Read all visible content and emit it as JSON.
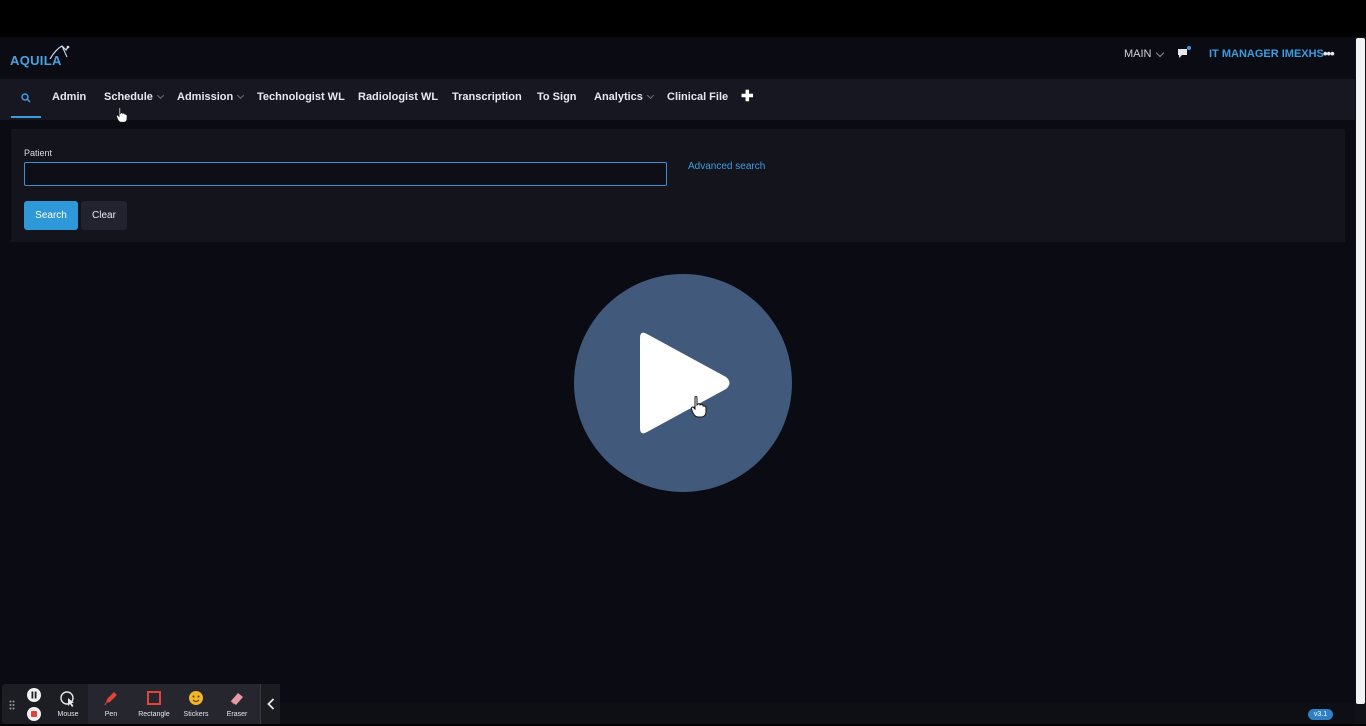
{
  "header": {
    "logo_text": "AQUILA",
    "context_select": "MAIN",
    "user_name": "IT MANAGER IMEXHS",
    "more_label": "•••",
    "chat_icon": "chat-bubble-icon"
  },
  "nav": {
    "search_icon": "search-icon",
    "items": [
      {
        "label": "Admin",
        "dropdown": false
      },
      {
        "label": "Schedule",
        "dropdown": true
      },
      {
        "label": "Admission",
        "dropdown": true
      },
      {
        "label": "Technologist WL",
        "dropdown": false
      },
      {
        "label": "Radiologist WL",
        "dropdown": false
      },
      {
        "label": "Transcription",
        "dropdown": false
      },
      {
        "label": "To Sign",
        "dropdown": false
      },
      {
        "label": "Analytics",
        "dropdown": true
      },
      {
        "label": "Clinical File",
        "dropdown": false
      }
    ],
    "add_label": "✚"
  },
  "search": {
    "patient_label": "Patient",
    "patient_value": "",
    "advanced_link": "Advanced search",
    "search_button": "Search",
    "clear_button": "Clear"
  },
  "overlay": {
    "play_icon": "play-icon"
  },
  "footer": {
    "version": "v3.1"
  },
  "recorder": {
    "tools": [
      {
        "label": "Mouse",
        "icon": "mouse-icon"
      },
      {
        "label": "Pen",
        "icon": "pen-icon"
      },
      {
        "label": "Rectangle",
        "icon": "rectangle-icon"
      },
      {
        "label": "Stickers",
        "icon": "sticker-icon"
      },
      {
        "label": "Eraser",
        "icon": "eraser-icon"
      }
    ]
  },
  "colors": {
    "accent": "#3b9de0",
    "background": "#0b0b13",
    "play_overlay": "#41597a"
  }
}
